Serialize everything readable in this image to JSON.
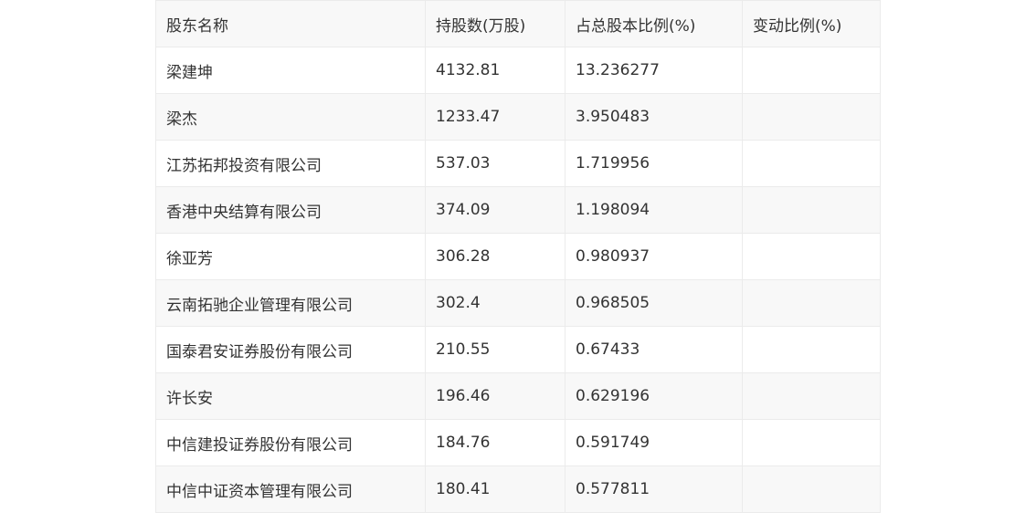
{
  "table": {
    "headers": [
      "股东名称",
      "持股数(万股)",
      "占总股本比例(%)",
      "变动比例(%)"
    ],
    "rows": [
      [
        "梁建坤",
        "4132.81",
        "13.236277",
        ""
      ],
      [
        "梁杰",
        "1233.47",
        "3.950483",
        ""
      ],
      [
        "江苏拓邦投资有限公司",
        "537.03",
        "1.719956",
        ""
      ],
      [
        "香港中央结算有限公司",
        "374.09",
        "1.198094",
        ""
      ],
      [
        "徐亚芳",
        "306.28",
        "0.980937",
        ""
      ],
      [
        "云南拓驰企业管理有限公司",
        "302.4",
        "0.968505",
        ""
      ],
      [
        "国泰君安证券股份有限公司",
        "210.55",
        "0.67433",
        ""
      ],
      [
        "许长安",
        "196.46",
        "0.629196",
        ""
      ],
      [
        "中信建投证券股份有限公司",
        "184.76",
        "0.591749",
        ""
      ],
      [
        "中信中证资本管理有限公司",
        "180.41",
        "0.577811",
        ""
      ]
    ]
  }
}
